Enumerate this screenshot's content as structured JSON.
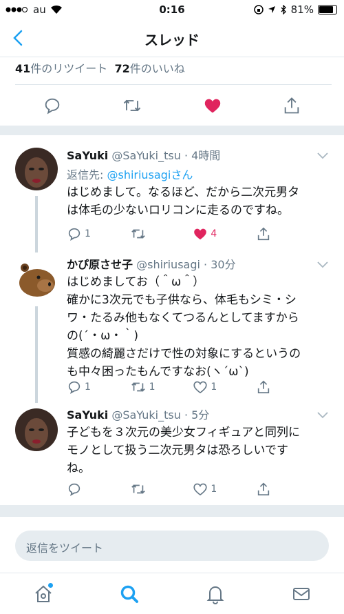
{
  "status": {
    "carrier": "au",
    "time": "0:16",
    "battery": "81%"
  },
  "nav": {
    "title": "スレッド"
  },
  "main_stats": {
    "retweets": "41",
    "retweets_label": "件のリツイート",
    "likes": "72",
    "likes_label": "件のいいね"
  },
  "tweets": [
    {
      "name": "SaYuki",
      "handle": "@SaYuki_tsu",
      "time": "· 4時間",
      "reply_prefix": "返信先: ",
      "reply_to": "@shiriusagiさん",
      "text": "はじめまして。なるほど、だから二次元男タ\nは体毛の少ないロリコンに走るのですね。",
      "replies": "1",
      "retweets": "",
      "likes": "4",
      "liked": true
    },
    {
      "name": "かぴ原させ子",
      "handle": "@shiriusagi",
      "time": "· 30分",
      "text": "はじめましてお（＾ω＾）\n確かに3次元でも子供なら、体毛もシミ・シ\nワ・たるみ他もなくてつるんとしてますから\nの(´・ω・｀)\n質感の綺麗さだけで性の対象にするというの\nも中々困ったもんですなお(ヽ´ω`)",
      "replies": "1",
      "retweets": "1",
      "likes": "1",
      "liked": false
    },
    {
      "name": "SaYuki",
      "handle": "@SaYuki_tsu",
      "time": "· 5分",
      "text": "子どもを３次元の美少女フィギュアと同列に\nモノとして扱う二次元男タは恐ろしいです\nね。",
      "replies": "",
      "retweets": "",
      "likes": "1",
      "liked": false
    }
  ],
  "composer": {
    "placeholder": "返信をツイート"
  },
  "colors": {
    "accent": "#1da1f2",
    "like": "#e0245e",
    "muted": "#657786"
  }
}
